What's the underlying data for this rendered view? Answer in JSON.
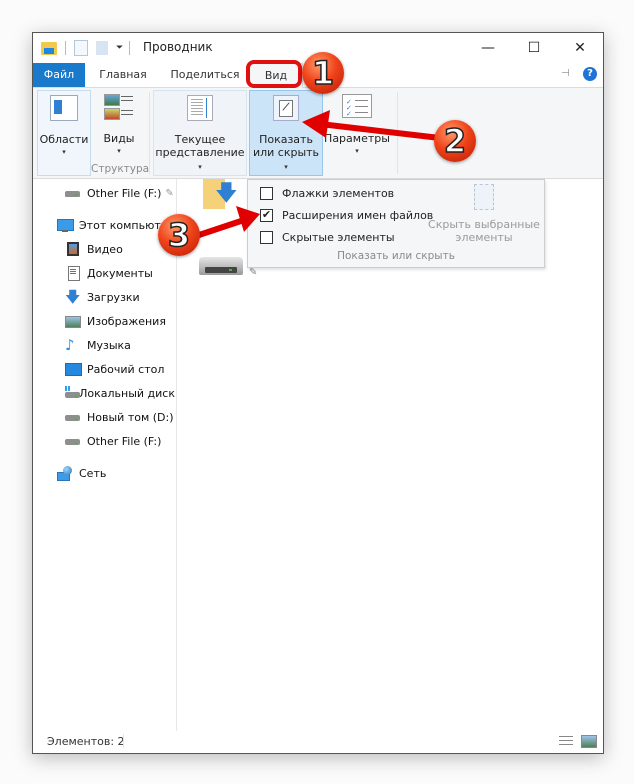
{
  "window": {
    "title": "Проводник",
    "controls": {
      "minimize": "—",
      "maximize": "☐",
      "close": "✕"
    }
  },
  "tabs": [
    {
      "label": "Файл",
      "active": false
    },
    {
      "label": "Главная",
      "active": false
    },
    {
      "label": "Поделиться",
      "active": false
    },
    {
      "label": "Вид",
      "active": true
    }
  ],
  "ribbon": {
    "oblasti": {
      "label": "Области",
      "caret": "▾"
    },
    "vidy": {
      "label": "Виды",
      "caret": "▾"
    },
    "structure_group": "Структура",
    "current_view": {
      "line1": "Текущее",
      "line2": "представление",
      "caret": "▾"
    },
    "show_hide": {
      "line1": "Показать",
      "line2": "или скрыть",
      "caret": "▾"
    },
    "params": {
      "label": "Параметры",
      "caret": "▾"
    }
  },
  "dropdown": {
    "items": [
      {
        "label": "Флажки элементов",
        "checked": false
      },
      {
        "label": "Расширения имен файлов",
        "checked": true
      },
      {
        "label": "Скрытые элементы",
        "checked": false
      }
    ],
    "hide_selected": {
      "line1": "Скрыть выбранные",
      "line2": "элементы"
    },
    "group_label": "Показать или скрыть",
    "check_glyph": "✔"
  },
  "nav": {
    "quick_access_item": "Other File (F:)",
    "this_pc": "Этот компьютер",
    "items": [
      "Видео",
      "Документы",
      "Загрузки",
      "Изображения",
      "Музыка",
      "Рабочий стол",
      "Локальный диск",
      "Новый том (D:)",
      "Other File (F:)"
    ],
    "network": "Сеть"
  },
  "status": {
    "count": "Элементов: 2"
  },
  "annotations": {
    "step1": "1",
    "step2": "2",
    "step3": "3",
    "arrow_color": "#e00000",
    "highlight_color": "#e01010"
  },
  "colors": {
    "file_tab": "#1979ca",
    "ribbon_bg": "#f5f6f7",
    "selected_button": "#cce4f7"
  }
}
